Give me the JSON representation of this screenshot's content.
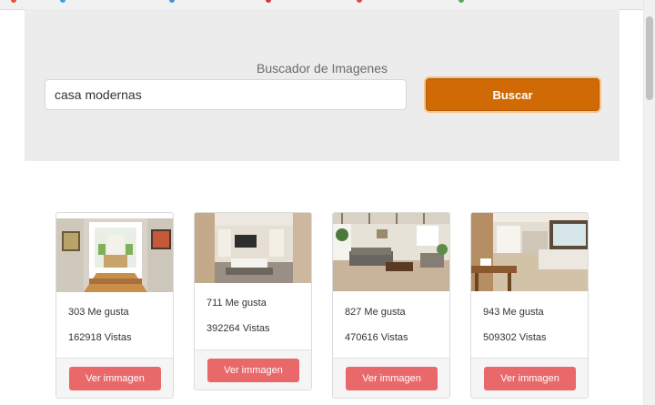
{
  "app": {
    "title": "Buscador de Imagenes"
  },
  "search": {
    "value": "casa modernas",
    "button_label": "Buscar"
  },
  "colors": {
    "accent": "#d06a04",
    "button": "#e9696a",
    "panel": "#ececec"
  },
  "results": [
    {
      "likes": "303 Me gusta",
      "views": "162918 Vistas",
      "button_label": "Ver immagen"
    },
    {
      "likes": "711 Me gusta",
      "views": "392264 Vistas",
      "button_label": "Ver immagen"
    },
    {
      "likes": "827 Me gusta",
      "views": "470616 Vistas",
      "button_label": "Ver immagen"
    },
    {
      "likes": "943 Me gusta",
      "views": "509302 Vistas",
      "button_label": "Ver immagen"
    }
  ]
}
